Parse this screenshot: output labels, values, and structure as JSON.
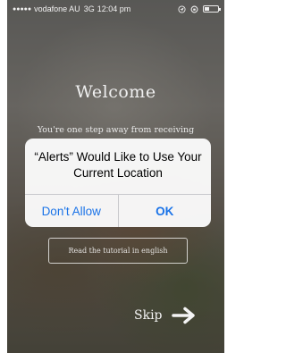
{
  "status_bar": {
    "signal": "●●●●●",
    "carrier": "vodafone AU",
    "network": "3G",
    "time": "12:04 pm",
    "icons": [
      "location-icon",
      "orientation-lock-icon",
      "battery-icon"
    ],
    "battery_level": 0.35
  },
  "welcome": {
    "title": "Welcome",
    "subtitle": "You're one step away from receiving"
  },
  "tutorial_button_label": "Read the tutorial in english",
  "skip_label": "Skip",
  "alert": {
    "title": "“Alerts” Would Like to Use Your Current Location",
    "dont_allow": "Don't Allow",
    "ok": "OK",
    "accent_color": "#1a73e8"
  }
}
